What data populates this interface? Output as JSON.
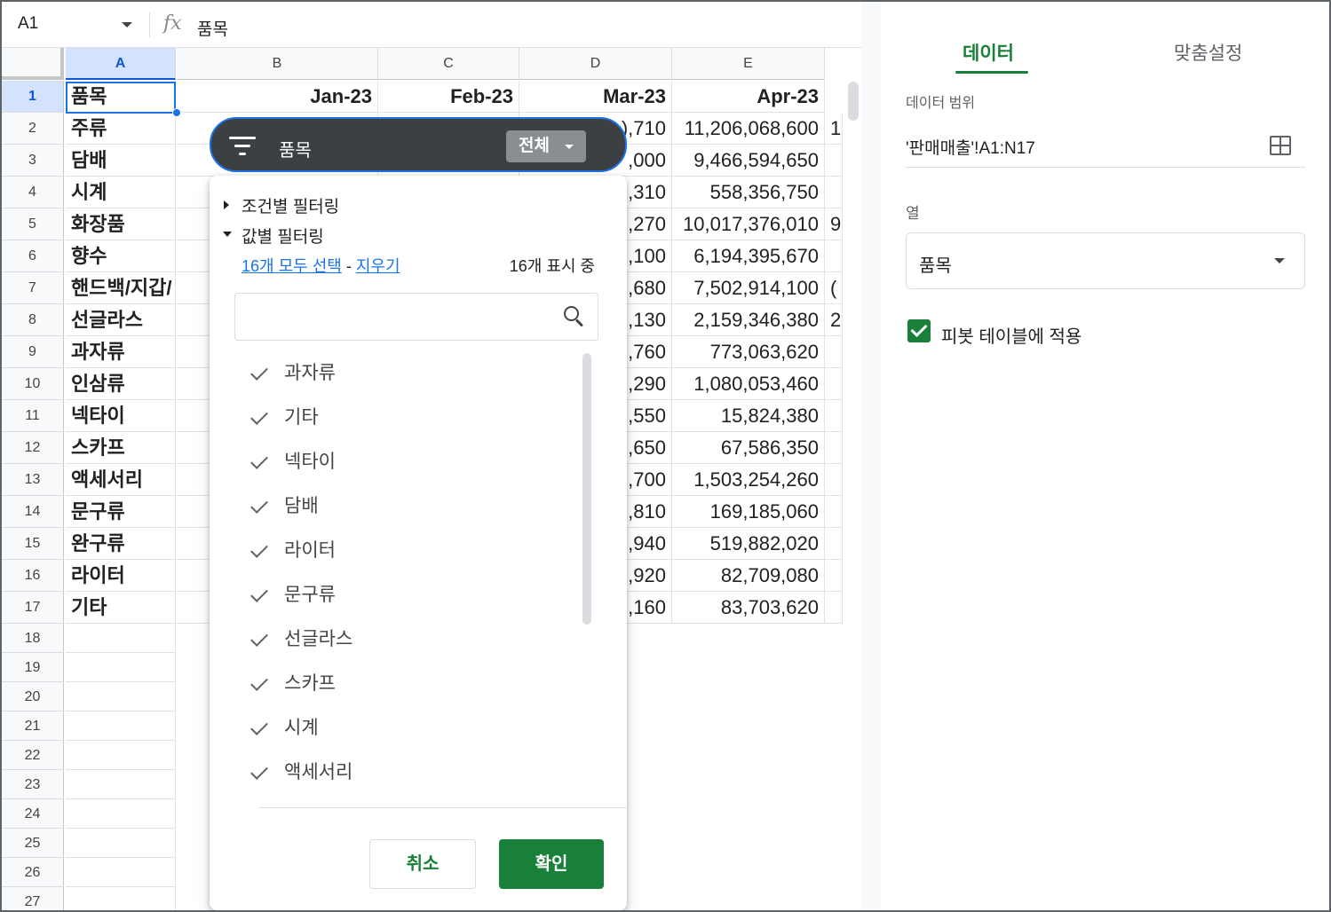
{
  "formula_bar": {
    "cell_ref": "A1",
    "fx": "fx",
    "value": "품목"
  },
  "grid": {
    "columns": [
      "A",
      "B",
      "C",
      "D",
      "E"
    ],
    "rows": [
      "1",
      "2",
      "3",
      "4",
      "5",
      "6",
      "7",
      "8",
      "9",
      "10",
      "11",
      "12",
      "13",
      "14",
      "15",
      "16",
      "17",
      "18",
      "19",
      "20",
      "21",
      "22",
      "23",
      "24",
      "25",
      "26",
      "27"
    ],
    "header_row": [
      "품목",
      "Jan-23",
      "Feb-23",
      "Mar-23",
      "Apr-23"
    ],
    "items": [
      "주류",
      "담배",
      "시계",
      "화장품",
      "향수",
      "핸드백/지갑/",
      "선글라스",
      "과자류",
      "인삼류",
      "넥타이",
      "스카프",
      "액세서리",
      "문구류",
      "완구류",
      "라이터",
      "기타"
    ],
    "col_d_partial": [
      "),710",
      ",000",
      ",310",
      ",270",
      ",100",
      ",680",
      ",130",
      ",760",
      ",290",
      ",550",
      ",650",
      ",700",
      ",810",
      ",940",
      ",920",
      ",160"
    ],
    "col_e": [
      "11,206,068,600",
      "9,466,594,650",
      "558,356,750",
      "10,017,376,010",
      "6,194,395,670",
      "7,502,914,100",
      "2,159,346,380",
      "773,063,620",
      "1,080,053,460",
      "15,824,380",
      "67,586,350",
      "1,503,254,260",
      "169,185,060",
      "519,882,020",
      "82,709,080",
      "83,703,620"
    ],
    "col_f_partial": [
      "1(",
      "",
      "",
      "9",
      "",
      "(",
      "2",
      "",
      "",
      "",
      "",
      "",
      "",
      "",
      "",
      ""
    ]
  },
  "filter": {
    "title": "품목",
    "all_button": "전체",
    "condition_section": "조건별 필터링",
    "value_section": "값별 필터링",
    "select_all": "16개 모두 선택",
    "separator": " - ",
    "clear": "지우기",
    "shown_count": "16개 표시 중",
    "search_placeholder": "",
    "values": [
      "과자류",
      "기타",
      "넥타이",
      "담배",
      "라이터",
      "문구류",
      "선글라스",
      "스카프",
      "시계",
      "액세서리"
    ],
    "cancel": "취소",
    "ok": "확인"
  },
  "panel": {
    "tab_data": "데이터",
    "tab_custom": "맞춤설정",
    "range_label": "데이터 범위",
    "range_value": "'판매매출'!A1:N17",
    "column_label": "열",
    "column_value": "품목",
    "apply_pivot": "피봇 테이블에 적용",
    "apply_pivot_checked": true
  },
  "colors": {
    "accent_green": "#188038",
    "selection_blue": "#1a73e8"
  }
}
